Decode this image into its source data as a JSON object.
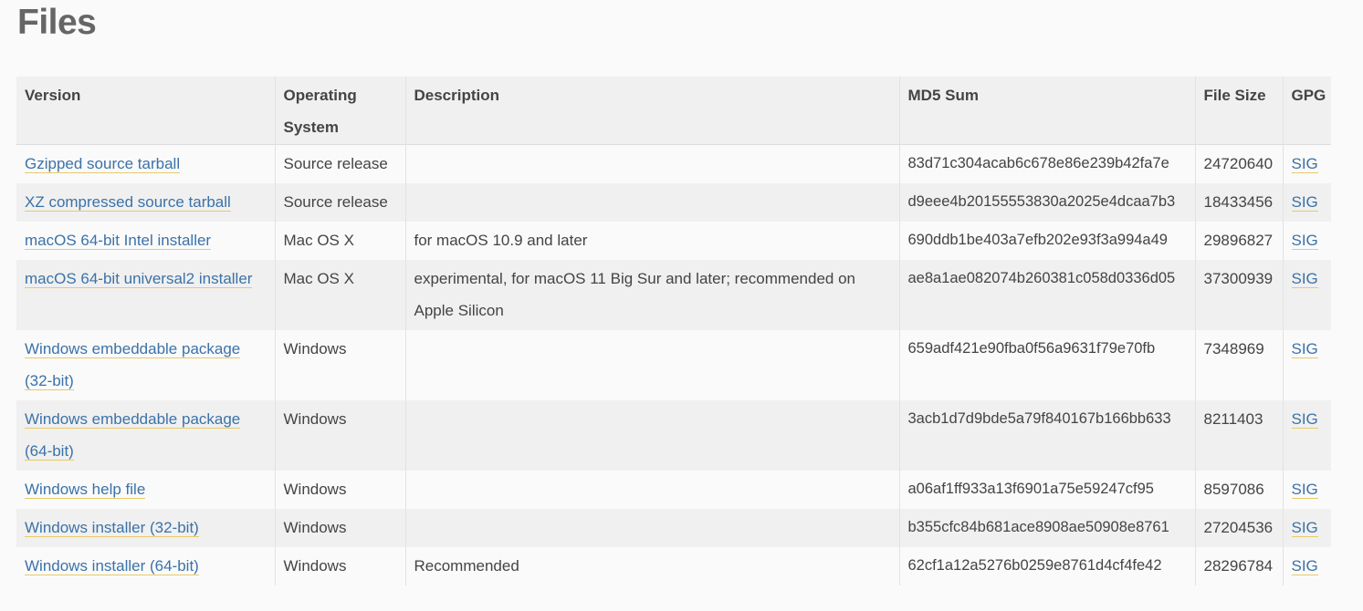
{
  "page": {
    "title": "Files"
  },
  "table": {
    "headers": {
      "version": "Version",
      "os": "Operating System",
      "description": "Description",
      "md5": "MD5 Sum",
      "size": "File Size",
      "gpg": "GPG"
    },
    "rows": [
      {
        "version": "Gzipped source tarball",
        "os": "Source release",
        "description": "",
        "md5": "83d71c304acab6c678e86e239b42fa7e",
        "size": "24720640",
        "gpg": "SIG"
      },
      {
        "version": "XZ compressed source tarball",
        "os": "Source release",
        "description": "",
        "md5": "d9eee4b20155553830a2025e4dcaa7b3",
        "size": "18433456",
        "gpg": "SIG"
      },
      {
        "version": "macOS 64-bit Intel installer",
        "os": "Mac OS X",
        "description": "for macOS 10.9 and later",
        "md5": "690ddb1be403a7efb202e93f3a994a49",
        "size": "29896827",
        "gpg": "SIG"
      },
      {
        "version": "macOS 64-bit universal2 installer",
        "os": "Mac OS X",
        "description": "experimental, for macOS 11 Big Sur and later; recommended on Apple Silicon",
        "md5": "ae8a1ae082074b260381c058d0336d05",
        "size": "37300939",
        "gpg": "SIG"
      },
      {
        "version": "Windows embeddable package (32-bit)",
        "os": "Windows",
        "description": "",
        "md5": "659adf421e90fba0f56a9631f79e70fb",
        "size": "7348969",
        "gpg": "SIG"
      },
      {
        "version": "Windows embeddable package (64-bit)",
        "os": "Windows",
        "description": "",
        "md5": "3acb1d7d9bde5a79f840167b166bb633",
        "size": "8211403",
        "gpg": "SIG"
      },
      {
        "version": "Windows help file",
        "os": "Windows",
        "description": "",
        "md5": "a06af1ff933a13f6901a75e59247cf95",
        "size": "8597086",
        "gpg": "SIG"
      },
      {
        "version": "Windows installer (32-bit)",
        "os": "Windows",
        "description": "",
        "md5": "b355cfc84b681ace8908ae50908e8761",
        "size": "27204536",
        "gpg": "SIG"
      },
      {
        "version": "Windows installer (64-bit)",
        "os": "Windows",
        "description": "Recommended",
        "md5": "62cf1a12a5276b0259e8761d4cf4fe42",
        "size": "28296784",
        "gpg": "SIG"
      }
    ]
  },
  "colors": {
    "link": "#3b72a8",
    "link_underline": "#e8c96a",
    "title": "#666666",
    "header_bg": "#f0f0f0",
    "row_alt_bg": "#f0f0f0",
    "page_bg": "#fafafa"
  }
}
